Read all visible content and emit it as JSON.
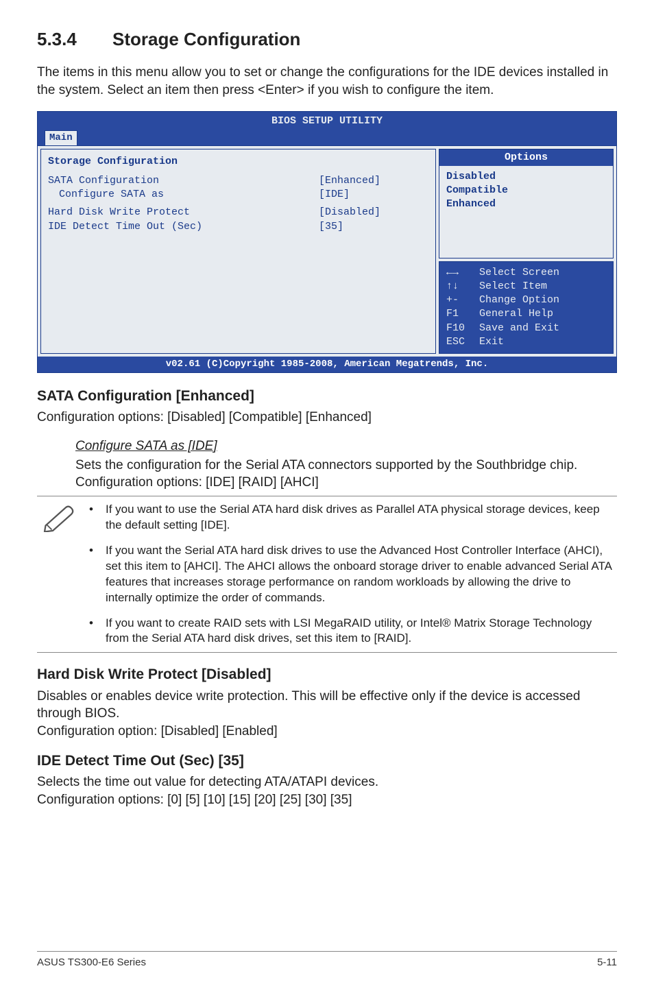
{
  "section": {
    "number": "5.3.4",
    "title": "Storage Configuration"
  },
  "intro": "The items in this menu allow you to set or change the configurations for the IDE devices installed in the system. Select an item then press <Enter> if you wish to configure the item.",
  "bios": {
    "utility_title": "BIOS SETUP UTILITY",
    "tab": "Main",
    "left_heading": "Storage Configuration",
    "rows": [
      {
        "label": "SATA Configuration",
        "value": "[Enhanced]",
        "indent": 0
      },
      {
        "label": "Configure SATA as",
        "value": "[IDE]",
        "indent": 1
      },
      {
        "label": "Hard Disk Write Protect",
        "value": "[Disabled]",
        "indent": 0
      },
      {
        "label": "IDE Detect Time Out (Sec)",
        "value": "[35]",
        "indent": 0
      }
    ],
    "options_label": "Options",
    "options": [
      "Disabled",
      "Compatible",
      "Enhanced"
    ],
    "nav": [
      {
        "sym": "←→",
        "txt": "Select Screen"
      },
      {
        "sym": "↑↓",
        "txt": "Select Item"
      },
      {
        "sym": "+-",
        "txt": "Change Option"
      },
      {
        "sym": "F1",
        "txt": "General Help"
      },
      {
        "sym": "F10",
        "txt": "Save and Exit"
      },
      {
        "sym": "ESC",
        "txt": "Exit"
      }
    ],
    "footer": "v02.61 (C)Copyright 1985-2008, American Megatrends, Inc."
  },
  "sata_conf": {
    "heading": "SATA Configuration [Enhanced]",
    "body": "Configuration options: [Disabled] [Compatible] [Enhanced]",
    "sub_heading": "Configure SATA as [IDE]",
    "sub_body": "Sets the configuration for the Serial ATA connectors supported by the Southbridge chip. Configuration options: [IDE] [RAID] [AHCI]"
  },
  "notes": [
    "If you want to use the Serial ATA hard disk drives as Parallel ATA physical storage devices, keep the default setting [IDE].",
    "If you want the Serial ATA hard disk drives to use the Advanced Host Controller Interface (AHCI), set this item to [AHCI]. The AHCI allows the onboard storage driver to enable advanced Serial ATA features that increases storage performance on random workloads by allowing the drive to internally optimize the order of commands.",
    "If you want to create RAID sets with LSI MegaRAID utility, or Intel® Matrix Storage Technology from the Serial ATA hard disk drives, set this item to [RAID]."
  ],
  "hdwp": {
    "heading": "Hard Disk Write Protect [Disabled]",
    "body1": "Disables or enables device write protection. This will be effective only if the device is accessed through BIOS.",
    "body2": "Configuration option: [Disabled] [Enabled]"
  },
  "ide_to": {
    "heading": "IDE Detect Time Out (Sec) [35]",
    "body1": "Selects the time out value for detecting ATA/ATAPI devices.",
    "body2": "Configuration options: [0] [5] [10] [15] [20] [25] [30] [35]"
  },
  "footer": {
    "left": "ASUS TS300-E6 Series",
    "right": "5-11"
  }
}
